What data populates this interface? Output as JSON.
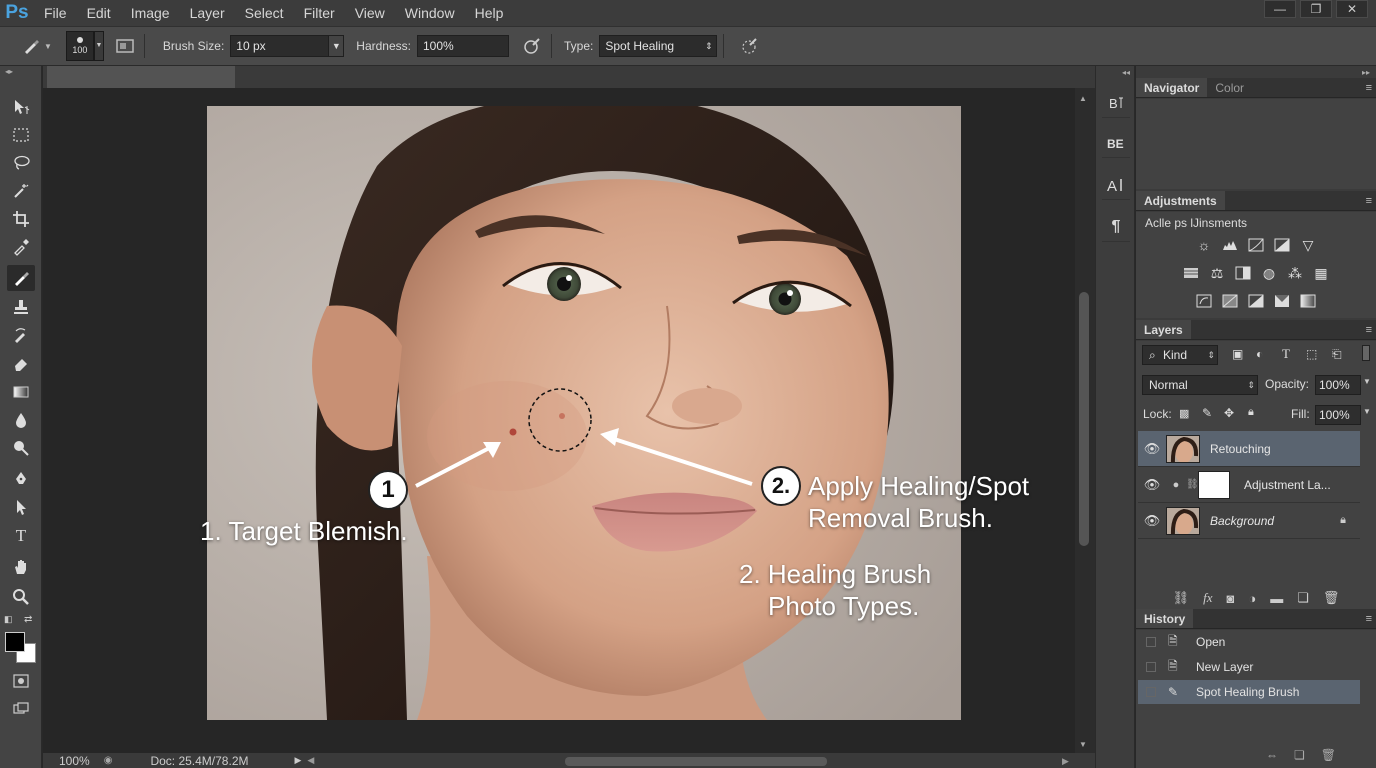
{
  "app": {
    "logo": "Ps",
    "menu": [
      "File",
      "Edit",
      "Image",
      "Layer",
      "Select",
      "Filter",
      "View",
      "Window",
      "Help"
    ]
  },
  "options": {
    "brush_preview_size": "100",
    "brush_size_label": "Brush Size:",
    "brush_size_value": "10 px",
    "hardness_label": "Hardness:",
    "hardness_value": "100%",
    "type_label": "Type:",
    "type_value": "Spot Healing"
  },
  "annotations": {
    "step1_number": "1",
    "step1_text": "1. Target Blemish.",
    "step2_number": "2.",
    "step2_line1": "Apply Healing/Spot",
    "step2_line2": "Removal Brush.",
    "caption_line1": "2. Healing Brush",
    "caption_line2": "Photo Types."
  },
  "status": {
    "zoom": "100%",
    "doc": "Doc: 25.4M/78.2M"
  },
  "panels": {
    "navigator_tab": "Navigator",
    "color_tab": "Color",
    "adjustments_tab": "Adjustments",
    "adjustments_subtitle": "Aclle ps lJinsments",
    "layers_tab": "Layers",
    "kind_label": "Kind",
    "blend_mode": "Normal",
    "opacity_label": "Opacity:",
    "opacity_value": "100%",
    "lock_label": "Lock:",
    "fill_label": "Fill:",
    "fill_value": "100%",
    "layers": [
      {
        "name": "Retouching",
        "selected": true
      },
      {
        "name": "Adjustment La...",
        "selected": false
      },
      {
        "name": "Background",
        "selected": false
      }
    ],
    "history_tab": "History",
    "history": [
      {
        "label": "Open",
        "icon": "document-icon"
      },
      {
        "label": "New Layer",
        "icon": "document-icon"
      },
      {
        "label": "Spot Healing Brush",
        "icon": "healing-brush-icon"
      }
    ]
  },
  "colors": {
    "accent_logo": "#4aa3df",
    "selection": "#5a6470",
    "foreground": "#000000",
    "background": "#ffffff"
  }
}
